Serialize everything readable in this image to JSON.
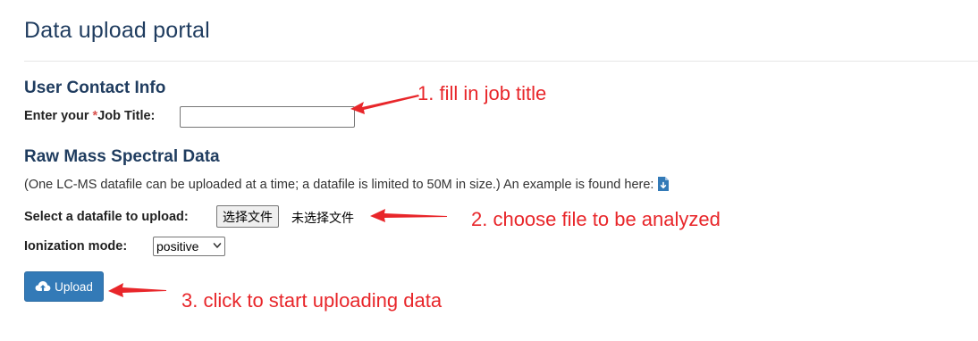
{
  "page": {
    "title": "Data upload portal"
  },
  "contact": {
    "heading": "User Contact Info",
    "job_label_prefix": "Enter your ",
    "job_label_star": "*",
    "job_label_suffix": "Job Title:",
    "job_value": ""
  },
  "raw": {
    "heading": "Raw Mass Spectral Data",
    "info": "(One LC-MS datafile can be uploaded at a time; a datafile is limited to 50M in size.) An example is found here:",
    "example_icon": "download-file-icon",
    "file_label": "Select a datafile to upload:",
    "file_button": "选择文件",
    "file_status": "未选择文件",
    "ion_label": "Ionization mode:",
    "ion_selected": "positive"
  },
  "actions": {
    "upload_label": "Upload",
    "upload_icon": "cloud-upload-icon"
  },
  "annotations": {
    "step1": "1. fill in job title",
    "step2": "2. choose file to be analyzed",
    "step3": "3. click to start uploading data",
    "color": "#e8262a"
  },
  "colors": {
    "heading": "#1f3c5f",
    "primary_button": "#337ab7",
    "required": "#d9534f"
  }
}
